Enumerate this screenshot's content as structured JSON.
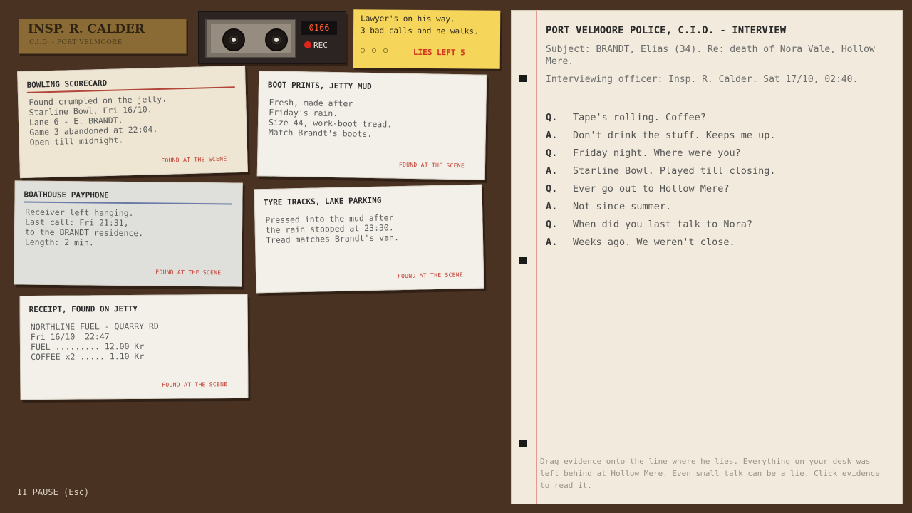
{
  "nameplate": {
    "name": "INSP. R. CALDER",
    "dept": "C.I.D. - PORT VELMOORE"
  },
  "recorder": {
    "counter": "0166",
    "rec_label": "REC"
  },
  "sticky": {
    "line1": "Lawyer's on his way.",
    "line2": "3 bad calls and he walks.",
    "dots": "○ ○ ○",
    "lies_left": "LIES LEFT 5"
  },
  "cards": {
    "bowling": {
      "title": "BOWLING SCORECARD",
      "body": "Found crumpled on the jetty.\nStarline Bowl, Fri 16/10.\nLane 6 - E. BRANDT.\nGame 3 abandoned at 22:04.\nOpen till midnight.",
      "found": "FOUND AT THE SCENE"
    },
    "bootprints": {
      "title": "BOOT PRINTS, JETTY MUD",
      "body": "Fresh, made after\nFriday's rain.\nSize 44, work-boot tread.\nMatch Brandt's boots.",
      "found": "FOUND AT THE SCENE"
    },
    "payphone": {
      "title": "BOATHOUSE PAYPHONE",
      "body": "Receiver left hanging.\nLast call: Fri 21:31,\nto the BRANDT residence.\nLength: 2 min.",
      "found": "FOUND AT THE SCENE"
    },
    "tyres": {
      "title": "TYRE TRACKS, LAKE PARKING",
      "body": "Pressed into the mud after\nthe rain stopped at 23:30.\nTread matches Brandt's van.",
      "found": "FOUND AT THE SCENE"
    },
    "receipt": {
      "title": "RECEIPT, FOUND ON JETTY",
      "body": "NORTHLINE FUEL - QUARRY RD\nFri 16/10  22:47\nFUEL ......... 12.00 Kr\nCOFFEE x2 ..... 1.10 Kr",
      "found": "FOUND AT THE SCENE"
    }
  },
  "transcript": {
    "heading": "PORT VELMOORE POLICE, C.I.D. - INTERVIEW",
    "subject": "Subject: BRANDT, Elias (34). Re: death of Nora Vale, Hollow Mere.",
    "officer": "Interviewing officer: Insp. R. Calder. Sat 17/10, 02:40.",
    "lines": [
      {
        "tag": "Q.",
        "text": "Tape's rolling. Coffee?"
      },
      {
        "tag": "A.",
        "text": "Don't drink the stuff. Keeps me up."
      },
      {
        "tag": "Q.",
        "text": "Friday night. Where were you?"
      },
      {
        "tag": "A.",
        "text": "Starline Bowl. Played till closing."
      },
      {
        "tag": "Q.",
        "text": "Ever go out to Hollow Mere?"
      },
      {
        "tag": "A.",
        "text": "Not since summer."
      },
      {
        "tag": "Q.",
        "text": "When did you last talk to Nora?"
      },
      {
        "tag": "A.",
        "text": "Weeks ago. We weren't close."
      }
    ],
    "hint": "Drag evidence onto the line where he lies. Everything on your desk was left behind at Hollow Mere. Even small talk can be a lie. Click evidence to read it."
  },
  "pause": "II  PAUSE (Esc)",
  "colors": {
    "desk": "#4a3222",
    "sticky": "#f5d65a",
    "accent_red": "#c0392b",
    "counter": "#ff5a2c"
  }
}
